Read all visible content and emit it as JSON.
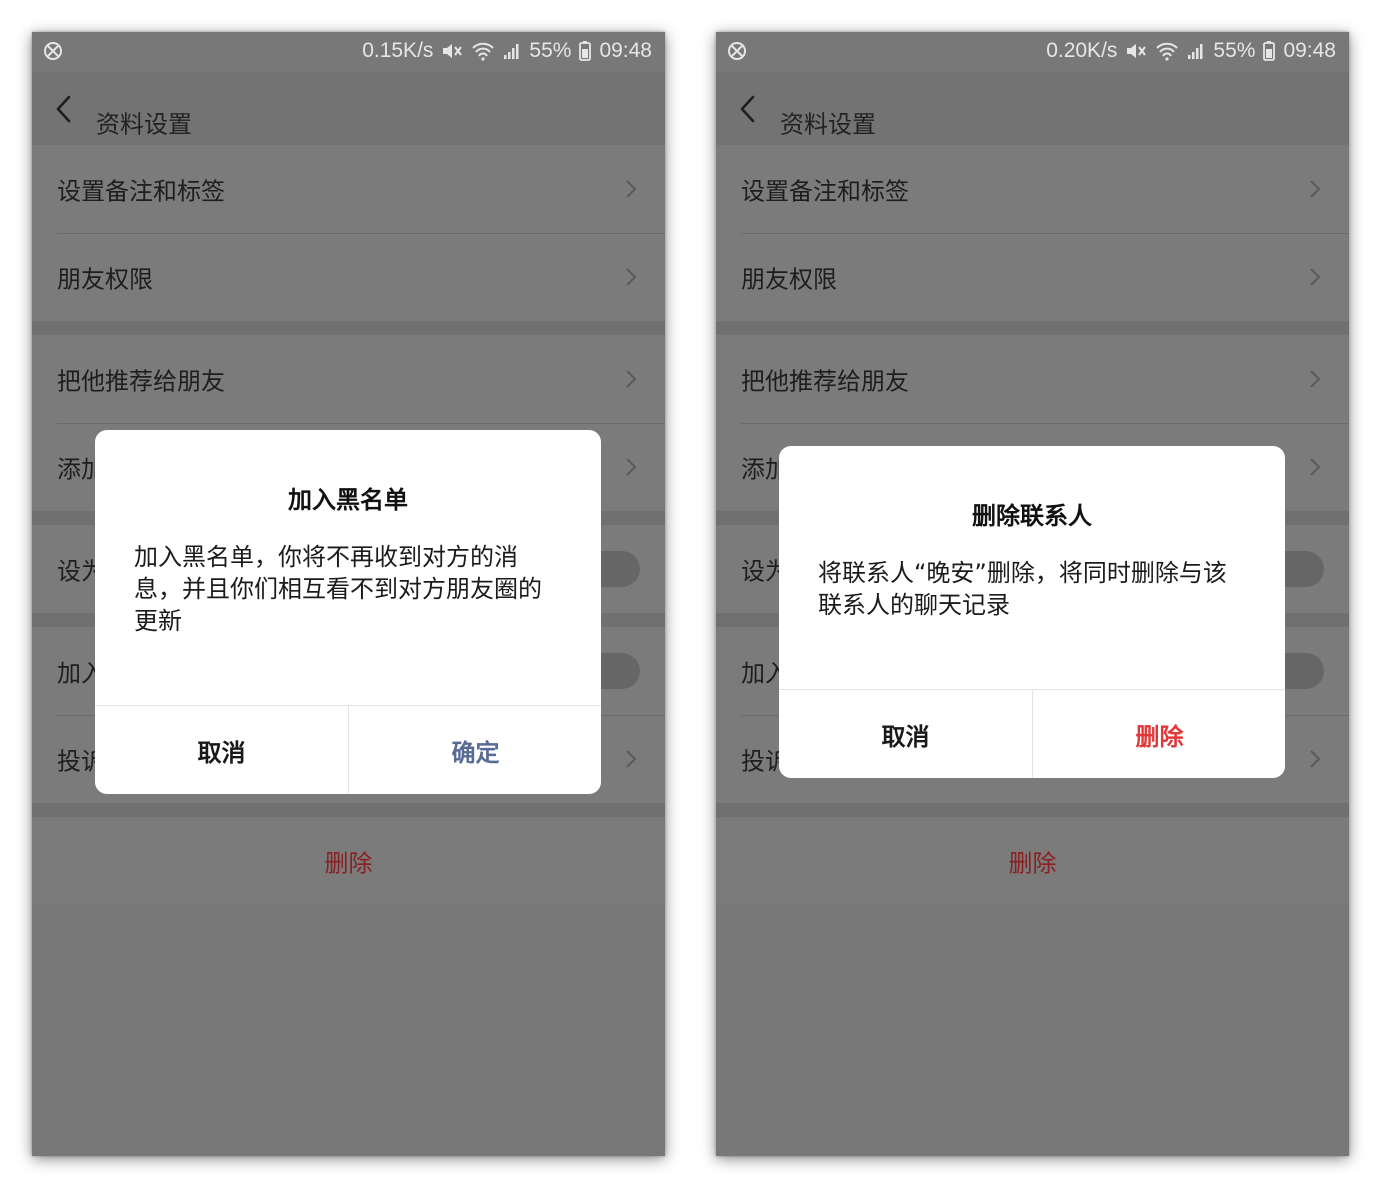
{
  "colors": {
    "confirm_blue": "#586b96",
    "delete_red": "#e0393a",
    "delete_red_dim": "#8a2020"
  },
  "screens": [
    {
      "status": {
        "speed": "0.15K/s",
        "battery": "55%",
        "time": "09:48"
      },
      "header": {
        "title": "资料设置"
      },
      "rows": {
        "remark": "设置备注和标签",
        "permission": "朋友权限",
        "recommend": "把他推荐给朋友",
        "add_desktop": "添加",
        "set_star": "设为",
        "blacklist": "加入",
        "complain": "投诉"
      },
      "delete_label": "删除",
      "dialog": {
        "title": "加入黑名单",
        "body": "加入黑名单，你将不再收到对方的消息，并且你们相互看不到对方朋友圈的更新",
        "cancel": "取消",
        "confirm": "确定"
      }
    },
    {
      "status": {
        "speed": "0.20K/s",
        "battery": "55%",
        "time": "09:48"
      },
      "header": {
        "title": "资料设置"
      },
      "rows": {
        "remark": "设置备注和标签",
        "permission": "朋友权限",
        "recommend": "把他推荐给朋友",
        "add_desktop": "添加",
        "set_star": "设为",
        "blacklist": "加入",
        "complain": "投诉"
      },
      "delete_label": "删除",
      "dialog": {
        "title": "删除联系人",
        "body": "将联系人“晚安”删除，将同时删除与该联系人的聊天记录",
        "cancel": "取消",
        "confirm": "删除"
      }
    }
  ]
}
